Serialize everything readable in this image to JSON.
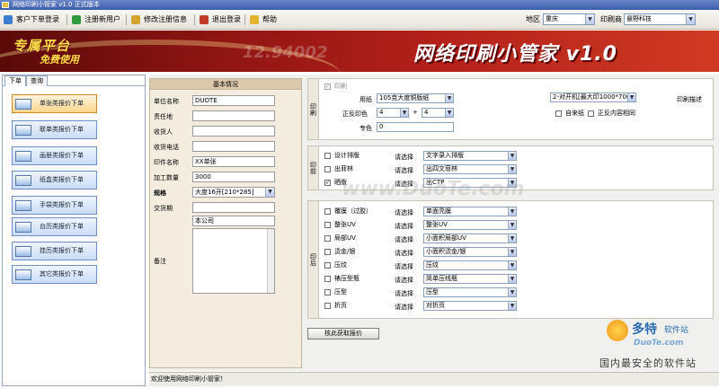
{
  "window": {
    "title": "网络印刷小管家 v1.0 正式版本"
  },
  "toolbar": {
    "buttons": [
      {
        "label": "客户下单登录",
        "color": "#3b7bd0"
      },
      {
        "label": "注册新用户",
        "color": "#2f9a3e"
      },
      {
        "label": "修改注册信息",
        "color": "#d8a431"
      },
      {
        "label": "退出登录",
        "color": "#c23b2a"
      },
      {
        "label": "帮助",
        "color": "#e2b52c"
      }
    ],
    "region_label": "地区",
    "region_value": "重庆",
    "printer_label": "印刷商",
    "printer_value": "悬野科技"
  },
  "banner": {
    "left_line1": "专属平台",
    "left_line2": "免费使用",
    "digits": "12.94002",
    "title": "网络印刷小管家 v1.0"
  },
  "sidebar": {
    "tabs": [
      "下单",
      "查询"
    ],
    "items": [
      "单张类报价下单",
      "联单类报价下单",
      "画册类报价下单",
      "纸盒类报价下单",
      "手袋类报价下单",
      "台历类报价下单",
      "挂历类报价下单",
      "其它类报价下单"
    ]
  },
  "basic": {
    "header": "基本情况",
    "fields": [
      {
        "label": "单位名称",
        "value": "DUOTE"
      },
      {
        "label": "责任地",
        "value": ""
      },
      {
        "label": "收货人",
        "value": ""
      },
      {
        "label": "收货电话",
        "value": ""
      },
      {
        "label": "印件名称",
        "value": "XX单张"
      },
      {
        "label": "加工数量",
        "value": "3000"
      }
    ],
    "spec_label": "规格",
    "spec_value": "大度16开[210*285]",
    "delivery_label": "交货期",
    "delivery_value": "",
    "company_value": "本公司",
    "remark_label": "备注"
  },
  "print": {
    "caption": "印刷",
    "print_check": "印刷",
    "paper_label": "用纸",
    "paper_value": "105克大度铜版纸",
    "desc_label": "印刷描述",
    "desc_value": "2-对开机[最大印1000*700",
    "color_label": "正反印色",
    "front_color": "4",
    "plus": "+",
    "back_color": "4",
    "spot_label": "专色",
    "spot_value": "0",
    "own_paper": "自来纸",
    "same_content": "正反内容相同"
  },
  "prepress": {
    "caption": "印前",
    "rows": [
      {
        "label": "设计排版",
        "checked": false,
        "prompt": "请选择",
        "value": "文字录入排版"
      },
      {
        "label": "出菲林",
        "checked": false,
        "prompt": "请选择",
        "value": "出四文菲林"
      },
      {
        "label": "晒版",
        "checked": true,
        "prompt": "请选择",
        "value": "出CTP"
      }
    ]
  },
  "postpress": {
    "caption": "印后",
    "rows": [
      {
        "label": "覆膜（过胶）",
        "checked": false,
        "prompt": "请选择",
        "value": "单面亮膜"
      },
      {
        "label": "整张UV",
        "checked": false,
        "prompt": "请选择",
        "value": "整张UV"
      },
      {
        "label": "局部UV",
        "checked": false,
        "prompt": "请选择",
        "value": "小面积局部UV"
      },
      {
        "label": "烫金/银",
        "checked": false,
        "prompt": "请选择",
        "value": "小面积烫金/银"
      },
      {
        "label": "压纹",
        "checked": false,
        "prompt": "请选择",
        "value": "压纹"
      },
      {
        "label": "裱压型瓶",
        "checked": false,
        "prompt": "请选择",
        "value": "简单压线瓶"
      },
      {
        "label": "压型",
        "checked": false,
        "prompt": "请选择",
        "value": "压型"
      },
      {
        "label": "折页",
        "checked": false,
        "prompt": "请选择",
        "value": "对折页"
      }
    ]
  },
  "calc_button": "核此获取报价",
  "status": "欢迎使用网络印刷小管家！",
  "watermarks": {
    "center": "www.DuoTe.com",
    "corner_cn": "多特",
    "corner_cn2": "软件站",
    "corner_en": "DuoTe.com",
    "corner_slogan": "国内最安全的软件站"
  }
}
